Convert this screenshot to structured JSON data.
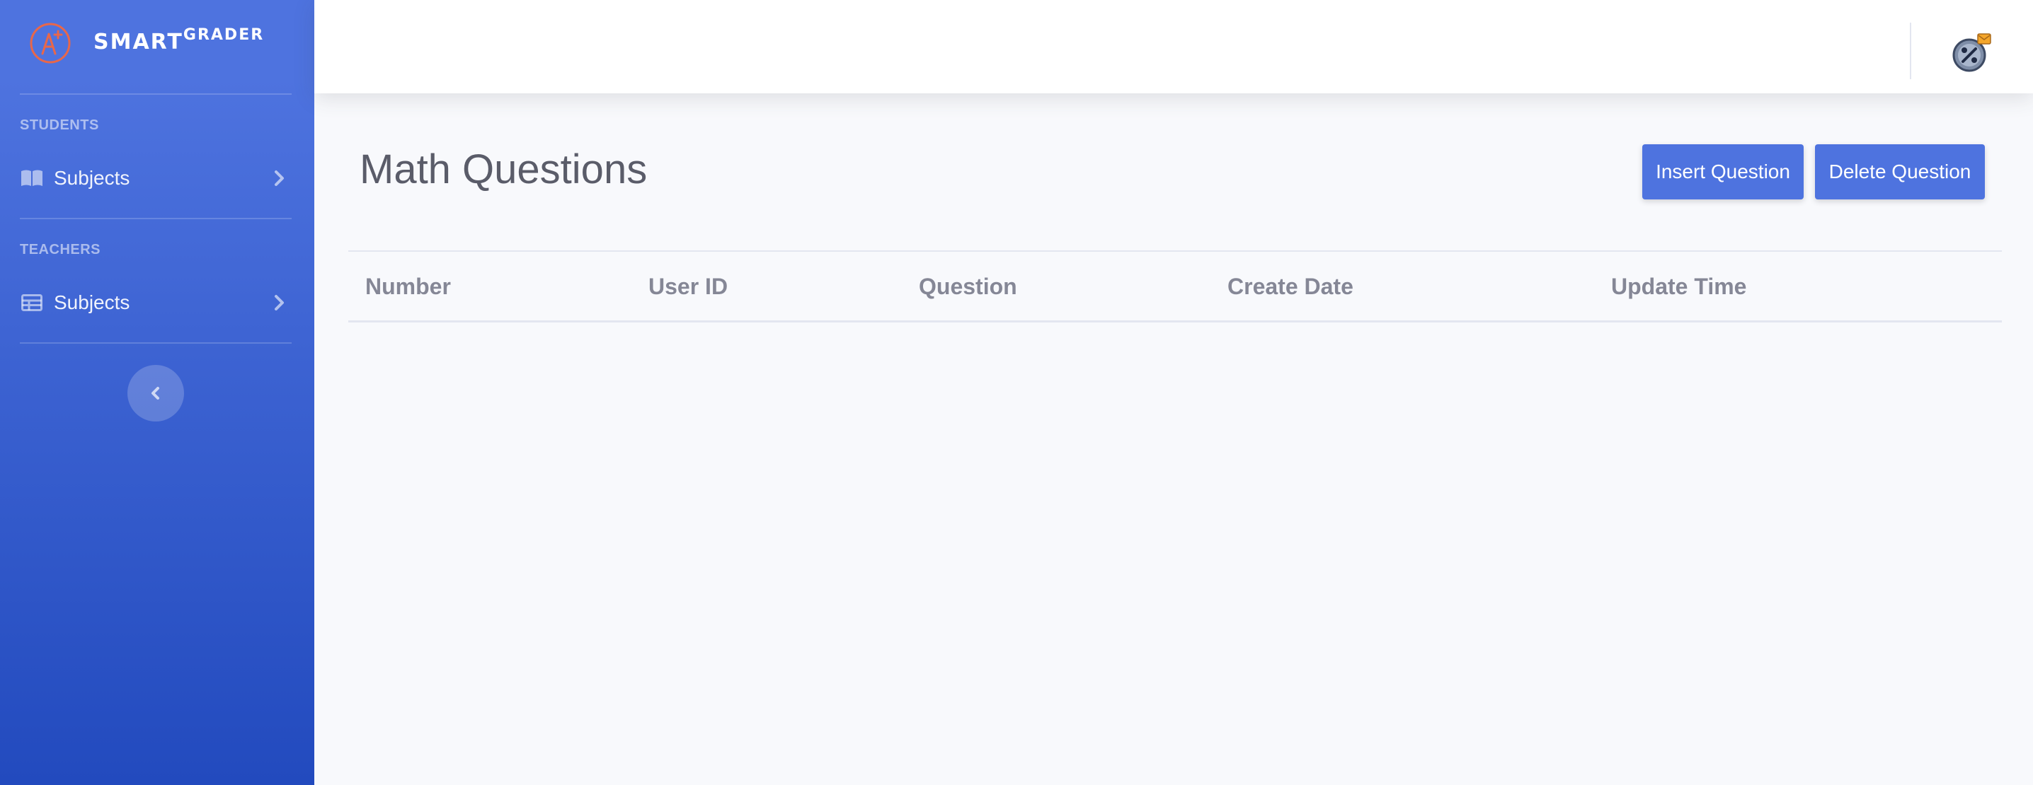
{
  "brand": {
    "name_main": "SMART",
    "name_super": "GRADER",
    "logo_icon": "a-plus-logo-icon"
  },
  "sidebar": {
    "sections": [
      {
        "heading": "STUDENTS",
        "items": [
          {
            "label": "Subjects",
            "icon": "book-open-icon"
          }
        ]
      },
      {
        "heading": "TEACHERS",
        "items": [
          {
            "label": "Subjects",
            "icon": "table-icon"
          }
        ]
      }
    ],
    "toggle_icon": "chevron-left-icon"
  },
  "topbar": {
    "user_avatar_icon": "percent-badge-avatar-icon"
  },
  "main": {
    "title": "Math Questions",
    "buttons": {
      "insert": "Insert Question",
      "delete": "Delete Question"
    },
    "table": {
      "columns": [
        "Number",
        "User ID",
        "Question",
        "Create Date",
        "Update Time"
      ],
      "rows": []
    }
  },
  "colors": {
    "primary": "#4e73df",
    "sidebar_gradient_end": "#224abe",
    "page_bg": "#f8f9fc",
    "heading_text": "#5a5c69",
    "muted_text": "#858796"
  }
}
